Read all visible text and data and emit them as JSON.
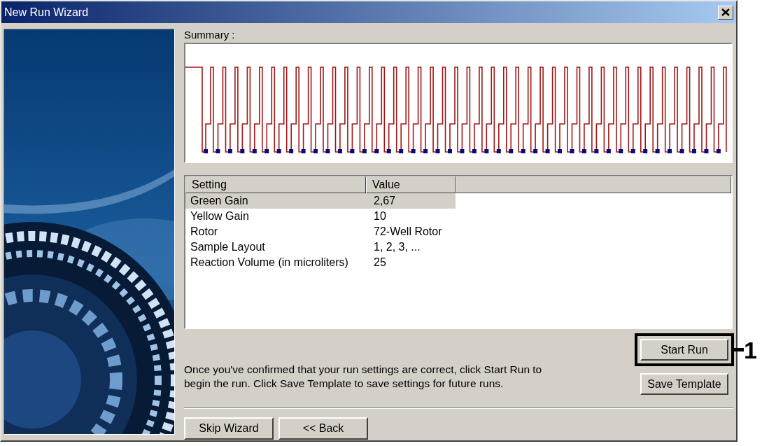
{
  "window": {
    "title": "New Run Wizard"
  },
  "summary": {
    "label": "Summary :"
  },
  "settings_table": {
    "columns": [
      "Setting",
      "Value"
    ],
    "rows": [
      {
        "setting": "Green Gain",
        "value": "2,67",
        "selected": true
      },
      {
        "setting": "Yellow Gain",
        "value": "10",
        "selected": false
      },
      {
        "setting": "Rotor",
        "value": "72-Well Rotor",
        "selected": false
      },
      {
        "setting": "Sample Layout",
        "value": "1, 2, 3, ...",
        "selected": false
      },
      {
        "setting": "Reaction Volume (in microliters)",
        "value": "25",
        "selected": false
      }
    ]
  },
  "instructions": "Once you've confirmed that your run settings are correct, click Start Run to begin the run. Click Save Template to save settings for future runs.",
  "action_buttons": [
    {
      "label": "Start Run",
      "highlighted": true
    },
    {
      "label": "Save Template",
      "highlighted": false
    }
  ],
  "nav_buttons": [
    "Skip Wizard",
    "<< Back"
  ],
  "callout": {
    "label": "1"
  }
}
